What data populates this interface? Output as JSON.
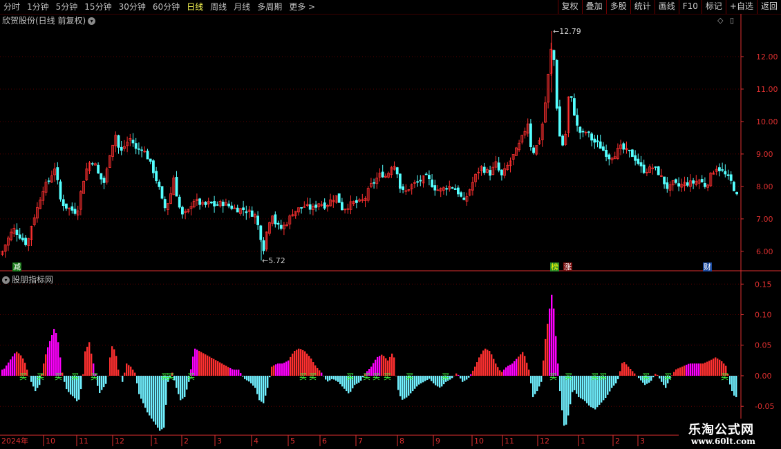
{
  "toolbar": {
    "tabs": [
      "分时",
      "1分钟",
      "5分钟",
      "15分钟",
      "30分钟",
      "60分钟",
      "日线",
      "周线",
      "月线",
      "多周期",
      "更多 >"
    ],
    "active_tab": "日线",
    "buttons": [
      "复权",
      "叠加",
      "多股",
      "统计",
      "画线",
      "F10",
      "标记",
      "+自选",
      "返回"
    ]
  },
  "chart_title": "欣贺股份(日线 前复权)",
  "indicator_title": "股朋指标网",
  "logo": {
    "line1": "乐淘公式网",
    "line2": "www.60lt.com"
  },
  "badges": {
    "left": "减",
    "bang": "榜",
    "zhang": "涨",
    "cai": "财"
  },
  "annotations": {
    "high": "12.79",
    "low": "5.72"
  },
  "colors": {
    "up": "#ff3030",
    "down": "#54ffff",
    "magenta": "#ff00ff",
    "hist_neg": "#70f0ff",
    "axis": "#e03030",
    "grid": "#5a0000"
  },
  "chart_data": [
    {
      "type": "candlestick",
      "y_ticks": [
        "12.00",
        "11.00",
        "10.00",
        "9.00",
        "8.00",
        "7.00",
        "6.00"
      ],
      "ylim": [
        5.55,
        13.0
      ],
      "x_labels": [
        "2024年",
        "10",
        "11",
        "12",
        "1",
        "2",
        "3",
        "4",
        "5",
        "6",
        "7",
        "8",
        "9",
        "10",
        "11",
        "12",
        "1",
        "2",
        "3"
      ],
      "high_point": 12.79,
      "low_point": 5.72,
      "close_path": [
        [
          0,
          5.9
        ],
        [
          8,
          6.3
        ],
        [
          18,
          6.7
        ],
        [
          30,
          6.4
        ],
        [
          38,
          6.2
        ],
        [
          45,
          6.9
        ],
        [
          52,
          7.3
        ],
        [
          60,
          7.9
        ],
        [
          70,
          8.2
        ],
        [
          78,
          8.6
        ],
        [
          86,
          7.6
        ],
        [
          92,
          7.4
        ],
        [
          100,
          7.3
        ],
        [
          110,
          7.2
        ],
        [
          118,
          8.1
        ],
        [
          126,
          8.7
        ],
        [
          134,
          8.8
        ],
        [
          142,
          8.3
        ],
        [
          150,
          8.1
        ],
        [
          158,
          9.1
        ],
        [
          166,
          9.6
        ],
        [
          172,
          9.0
        ],
        [
          180,
          9.3
        ],
        [
          188,
          9.5
        ],
        [
          196,
          9.1
        ],
        [
          204,
          9.2
        ],
        [
          212,
          8.9
        ],
        [
          220,
          8.5
        ],
        [
          228,
          8.0
        ],
        [
          236,
          7.3
        ],
        [
          244,
          7.6
        ],
        [
          250,
          8.3
        ],
        [
          256,
          7.5
        ],
        [
          262,
          7.1
        ],
        [
          270,
          7.2
        ],
        [
          278,
          7.6
        ],
        [
          286,
          7.5
        ],
        [
          294,
          7.4
        ],
        [
          302,
          7.5
        ],
        [
          310,
          7.4
        ],
        [
          320,
          7.5
        ],
        [
          330,
          7.4
        ],
        [
          340,
          7.3
        ],
        [
          350,
          7.3
        ],
        [
          360,
          7.2
        ],
        [
          368,
          7.1
        ],
        [
          374,
          6.6
        ],
        [
          380,
          6.1
        ],
        [
          386,
          6.8
        ],
        [
          392,
          7.2
        ],
        [
          398,
          6.8
        ],
        [
          406,
          6.7
        ],
        [
          414,
          6.9
        ],
        [
          422,
          7.2
        ],
        [
          430,
          7.3
        ],
        [
          440,
          7.4
        ],
        [
          450,
          7.3
        ],
        [
          460,
          7.5
        ],
        [
          470,
          7.4
        ],
        [
          478,
          7.6
        ],
        [
          486,
          7.7
        ],
        [
          494,
          7.3
        ],
        [
          502,
          7.4
        ],
        [
          510,
          7.5
        ],
        [
          518,
          7.5
        ],
        [
          526,
          7.6
        ],
        [
          534,
          8.0
        ],
        [
          542,
          8.2
        ],
        [
          550,
          8.4
        ],
        [
          558,
          8.3
        ],
        [
          566,
          8.7
        ],
        [
          572,
          8.6
        ],
        [
          578,
          7.9
        ],
        [
          584,
          7.8
        ],
        [
          592,
          8.0
        ],
        [
          600,
          8.1
        ],
        [
          608,
          8.2
        ],
        [
          616,
          8.3
        ],
        [
          622,
          8.1
        ],
        [
          630,
          7.9
        ],
        [
          638,
          7.9
        ],
        [
          646,
          8.0
        ],
        [
          654,
          8.0
        ],
        [
          662,
          7.8
        ],
        [
          670,
          7.5
        ],
        [
          678,
          7.9
        ],
        [
          686,
          8.3
        ],
        [
          694,
          8.6
        ],
        [
          700,
          8.5
        ],
        [
          708,
          8.4
        ],
        [
          716,
          8.7
        ],
        [
          724,
          8.3
        ],
        [
          732,
          8.6
        ],
        [
          740,
          8.9
        ],
        [
          748,
          9.2
        ],
        [
          756,
          9.6
        ],
        [
          762,
          10.0
        ],
        [
          768,
          9.0
        ],
        [
          774,
          9.2
        ],
        [
          780,
          9.5
        ],
        [
          786,
          10.3
        ],
        [
          792,
          11.5
        ],
        [
          798,
          12.6
        ],
        [
          804,
          10.5
        ],
        [
          810,
          9.2
        ],
        [
          816,
          9.4
        ],
        [
          822,
          11.0
        ],
        [
          828,
          10.4
        ],
        [
          834,
          9.8
        ],
        [
          840,
          9.6
        ],
        [
          848,
          9.7
        ],
        [
          856,
          9.4
        ],
        [
          864,
          9.3
        ],
        [
          872,
          9.1
        ],
        [
          880,
          8.9
        ],
        [
          888,
          9.0
        ],
        [
          896,
          9.2
        ],
        [
          904,
          9.1
        ],
        [
          912,
          9.0
        ],
        [
          920,
          8.8
        ],
        [
          928,
          8.5
        ],
        [
          936,
          8.5
        ],
        [
          944,
          8.6
        ],
        [
          952,
          8.4
        ],
        [
          960,
          8.1
        ],
        [
          966,
          7.9
        ],
        [
          972,
          8.1
        ],
        [
          980,
          8.0
        ],
        [
          990,
          8.1
        ],
        [
          1000,
          8.1
        ],
        [
          1010,
          8.2
        ],
        [
          1020,
          8.0
        ],
        [
          1026,
          8.3
        ],
        [
          1034,
          8.6
        ],
        [
          1042,
          8.5
        ],
        [
          1050,
          8.3
        ],
        [
          1058,
          8.1
        ],
        [
          1064,
          7.7
        ]
      ]
    },
    {
      "type": "bar",
      "y_ticks": [
        "0.15",
        "0.10",
        "0.05",
        "0.00",
        "-0.05"
      ],
      "ylim": [
        -0.095,
        0.165
      ],
      "signal_label": "买",
      "hist_path": [
        [
          4,
          0.01
        ],
        [
          10,
          0.02
        ],
        [
          16,
          0.03
        ],
        [
          22,
          0.04
        ],
        [
          28,
          0.035
        ],
        [
          34,
          0.025
        ],
        [
          38,
          0.01
        ],
        [
          44,
          -0.01
        ],
        [
          50,
          -0.025
        ],
        [
          56,
          -0.015
        ],
        [
          60,
          0.01
        ],
        [
          66,
          0.04
        ],
        [
          72,
          0.06
        ],
        [
          78,
          0.08
        ],
        [
          84,
          0.05
        ],
        [
          88,
          0.01
        ],
        [
          94,
          -0.02
        ],
        [
          100,
          -0.03
        ],
        [
          106,
          -0.035
        ],
        [
          112,
          -0.045
        ],
        [
          118,
          -0.01
        ],
        [
          122,
          0.04
        ],
        [
          128,
          0.055
        ],
        [
          132,
          0.03
        ],
        [
          136,
          0.01
        ],
        [
          142,
          -0.03
        ],
        [
          148,
          -0.02
        ],
        [
          154,
          -0.01
        ],
        [
          160,
          0.05
        ],
        [
          166,
          0.04
        ],
        [
          170,
          0.01
        ],
        [
          176,
          -0.01
        ],
        [
          182,
          0.02
        ],
        [
          188,
          0.015
        ],
        [
          194,
          0.005
        ],
        [
          200,
          -0.03
        ],
        [
          206,
          -0.045
        ],
        [
          212,
          -0.06
        ],
        [
          218,
          -0.07
        ],
        [
          224,
          -0.08
        ],
        [
          230,
          -0.09
        ],
        [
          236,
          -0.085
        ],
        [
          242,
          -0.01
        ],
        [
          248,
          0.005
        ],
        [
          254,
          -0.02
        ],
        [
          260,
          -0.04
        ],
        [
          266,
          -0.035
        ],
        [
          272,
          -0.01
        ],
        [
          280,
          0.045
        ],
        [
          288,
          0.04
        ],
        [
          296,
          0.035
        ],
        [
          304,
          0.03
        ],
        [
          312,
          0.025
        ],
        [
          320,
          0.02
        ],
        [
          328,
          0.015
        ],
        [
          336,
          0.01
        ],
        [
          344,
          0.01
        ],
        [
          352,
          -0.005
        ],
        [
          360,
          -0.01
        ],
        [
          368,
          -0.02
        ],
        [
          374,
          -0.04
        ],
        [
          380,
          -0.045
        ],
        [
          386,
          -0.02
        ],
        [
          392,
          0.015
        ],
        [
          400,
          0.02
        ],
        [
          408,
          0.02
        ],
        [
          416,
          0.025
        ],
        [
          424,
          0.04
        ],
        [
          432,
          0.045
        ],
        [
          440,
          0.04
        ],
        [
          448,
          0.03
        ],
        [
          456,
          0.015
        ],
        [
          464,
          0.005
        ],
        [
          472,
          -0.01
        ],
        [
          480,
          -0.005
        ],
        [
          488,
          -0.01
        ],
        [
          496,
          -0.02
        ],
        [
          504,
          -0.03
        ],
        [
          512,
          -0.015
        ],
        [
          520,
          -0.01
        ],
        [
          528,
          0.005
        ],
        [
          536,
          0.015
        ],
        [
          544,
          0.03
        ],
        [
          552,
          0.035
        ],
        [
          560,
          0.025
        ],
        [
          568,
          0.04
        ],
        [
          574,
          -0.02
        ],
        [
          580,
          -0.04
        ],
        [
          588,
          -0.035
        ],
        [
          596,
          -0.025
        ],
        [
          604,
          -0.015
        ],
        [
          612,
          -0.01
        ],
        [
          620,
          -0.005
        ],
        [
          628,
          -0.015
        ],
        [
          636,
          -0.02
        ],
        [
          644,
          -0.01
        ],
        [
          652,
          -0.005
        ],
        [
          660,
          0.005
        ],
        [
          668,
          -0.01
        ],
        [
          676,
          -0.005
        ],
        [
          684,
          0.01
        ],
        [
          692,
          0.03
        ],
        [
          700,
          0.045
        ],
        [
          708,
          0.04
        ],
        [
          716,
          0.02
        ],
        [
          724,
          0.005
        ],
        [
          732,
          0.015
        ],
        [
          740,
          0.02
        ],
        [
          748,
          0.03
        ],
        [
          756,
          0.04
        ],
        [
          764,
          0.01
        ],
        [
          770,
          -0.035
        ],
        [
          776,
          -0.025
        ],
        [
          782,
          -0.01
        ],
        [
          788,
          0.06
        ],
        [
          794,
          0.11
        ],
        [
          798,
          0.14
        ],
        [
          804,
          0.05
        ],
        [
          810,
          -0.04
        ],
        [
          816,
          -0.09
        ],
        [
          822,
          -0.06
        ],
        [
          828,
          -0.02
        ],
        [
          836,
          -0.035
        ],
        [
          844,
          -0.04
        ],
        [
          852,
          -0.05
        ],
        [
          860,
          -0.055
        ],
        [
          868,
          -0.045
        ],
        [
          876,
          -0.035
        ],
        [
          884,
          -0.02
        ],
        [
          892,
          -0.01
        ],
        [
          900,
          0.025
        ],
        [
          908,
          0.015
        ],
        [
          916,
          0.005
        ],
        [
          924,
          -0.005
        ],
        [
          932,
          -0.015
        ],
        [
          940,
          -0.01
        ],
        [
          948,
          0.005
        ],
        [
          956,
          -0.01
        ],
        [
          962,
          -0.02
        ],
        [
          968,
          -0.005
        ],
        [
          976,
          0.01
        ],
        [
          986,
          0.015
        ],
        [
          996,
          0.02
        ],
        [
          1006,
          0.02
        ],
        [
          1016,
          0.02
        ],
        [
          1026,
          0.025
        ],
        [
          1034,
          0.03
        ],
        [
          1042,
          0.025
        ],
        [
          1050,
          0.015
        ],
        [
          1056,
          -0.02
        ],
        [
          1062,
          -0.035
        ]
      ],
      "signals_x": [
        33,
        58,
        84,
        108,
        136,
        238,
        246,
        276,
        438,
        452,
        506,
        530,
        544,
        560,
        592,
        644,
        800,
        822,
        860,
        872,
        934,
        966,
        1048
      ]
    }
  ]
}
